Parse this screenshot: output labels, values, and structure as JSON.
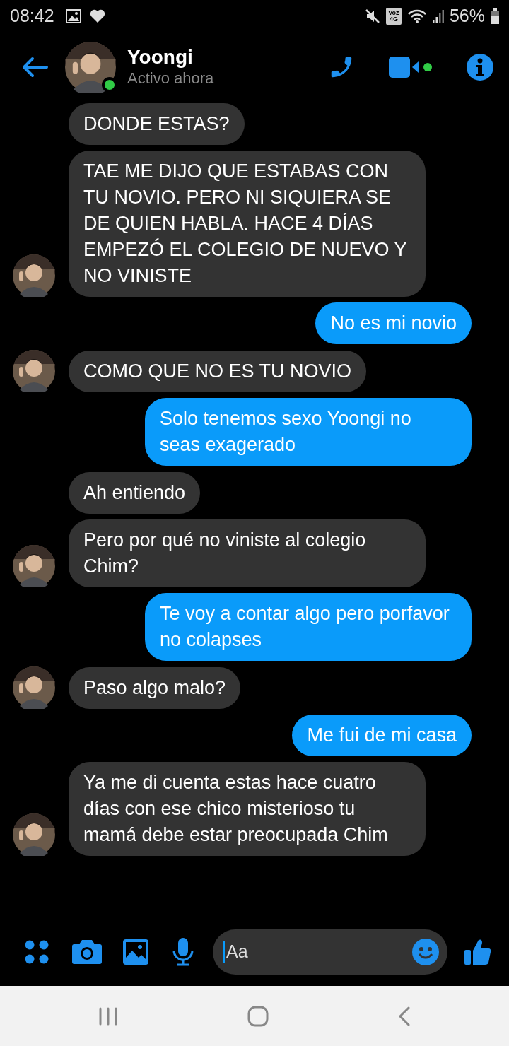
{
  "status_bar": {
    "time": "08:42",
    "network_badge": [
      "Voz",
      "4G"
    ],
    "battery": "56%"
  },
  "header": {
    "name": "Yoongi",
    "presence": "Activo ahora",
    "online": true
  },
  "messages": [
    {
      "kind": "incoming",
      "text": "DONDE ESTAS?",
      "avatar": false
    },
    {
      "kind": "incoming",
      "text": "TAE ME DIJO QUE ESTABAS CON TU NOVIO. PERO NI SIQUIERA SE DE QUIEN HABLA. HACE 4 DÍAS EMPEZÓ EL COLEGIO DE NUEVO Y NO VINISTE",
      "avatar": true
    },
    {
      "kind": "outgoing",
      "text": "No es mi novio"
    },
    {
      "kind": "incoming",
      "text": "COMO QUE NO ES TU NOVIO",
      "avatar": true
    },
    {
      "kind": "outgoing",
      "text": "Solo tenemos sexo Yoongi no seas exagerado"
    },
    {
      "kind": "incoming",
      "text": "Ah entiendo",
      "avatar": false
    },
    {
      "kind": "incoming",
      "text": "Pero por qué no viniste al colegio Chim?",
      "avatar": true
    },
    {
      "kind": "outgoing",
      "text": "Te voy a contar algo pero porfavor no colapses"
    },
    {
      "kind": "incoming",
      "text": "Paso algo malo?",
      "avatar": true
    },
    {
      "kind": "outgoing",
      "text": "Me fui de mi casa"
    },
    {
      "kind": "incoming",
      "text": "Ya me di cuenta estas hace cuatro días con ese chico misterioso tu mamá debe estar preocupada Chim",
      "avatar": true
    }
  ],
  "composer": {
    "placeholder": "Aa"
  }
}
